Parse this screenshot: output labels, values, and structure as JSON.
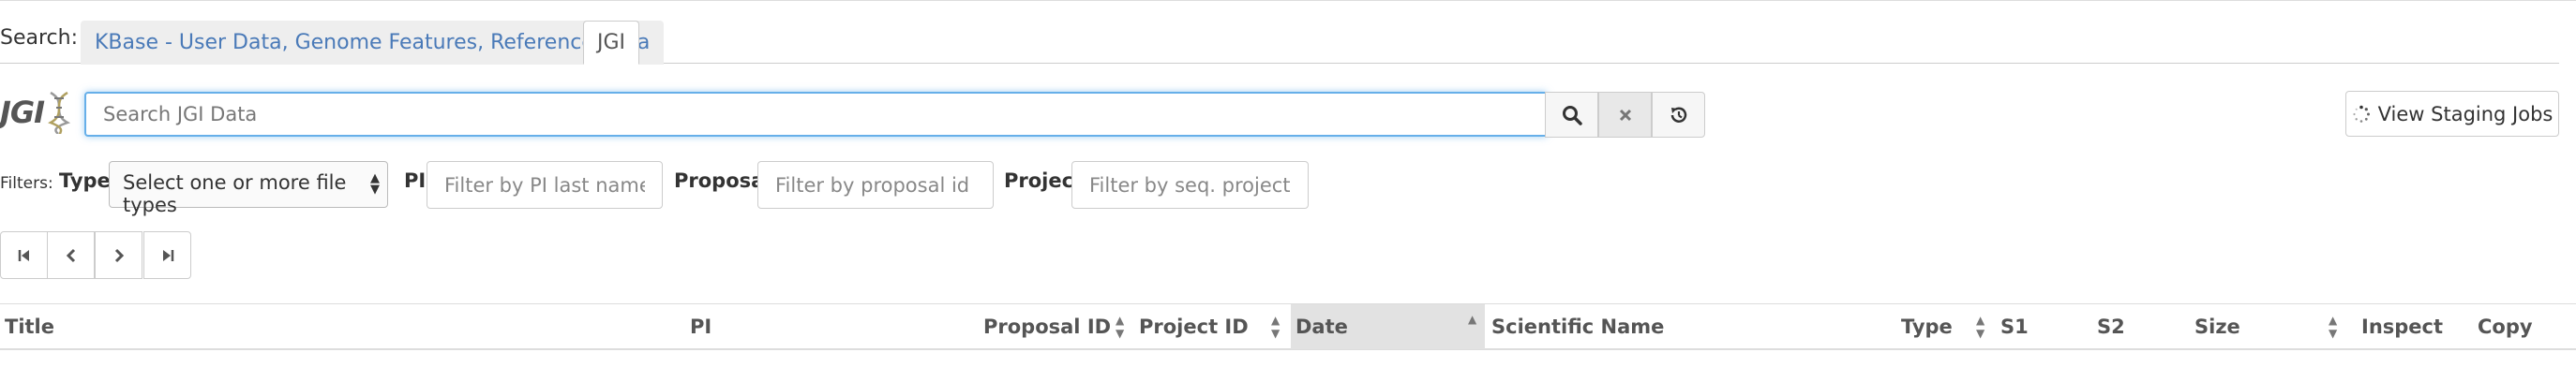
{
  "search_bar": {
    "label": "Search:",
    "tabs": [
      {
        "label": "KBase - User Data, Genome Features, Reference Data",
        "active": false
      },
      {
        "label": "JGI",
        "active": true
      }
    ]
  },
  "jgi": {
    "logo_text": "JGI",
    "search_placeholder": "Search JGI Data",
    "search_value": "",
    "staging_button_label": "View Staging Jobs"
  },
  "filters": {
    "label": "Filters:",
    "type_label": "Type",
    "type_select_value": "Select one or more file types",
    "pi_label": "PI",
    "pi_placeholder": "Filter by PI last name",
    "proposal_label": "Proposal",
    "proposal_placeholder": "Filter by proposal id",
    "project_label": "Project",
    "project_placeholder": "Filter by seq. project id"
  },
  "pagination": {
    "buttons": [
      "first-page",
      "previous-page",
      "next-page",
      "last-page"
    ]
  },
  "table": {
    "columns": [
      {
        "label": "Title",
        "sortable": false,
        "active": false
      },
      {
        "label": "PI",
        "sortable": false,
        "active": false
      },
      {
        "label": "Proposal ID",
        "sortable": true,
        "active": false
      },
      {
        "label": "Project ID",
        "sortable": true,
        "active": false
      },
      {
        "label": "Date",
        "sortable": true,
        "active": true,
        "sort_direction": "ascending"
      },
      {
        "label": "Scientific Name",
        "sortable": false,
        "active": false
      },
      {
        "label": "Type",
        "sortable": true,
        "active": false
      },
      {
        "label": "S1",
        "sortable": false,
        "active": false
      },
      {
        "label": "S2",
        "sortable": false,
        "active": false
      },
      {
        "label": "Size",
        "sortable": true,
        "active": false
      },
      {
        "label": "Inspect",
        "sortable": false,
        "active": false
      },
      {
        "label": "Copy",
        "sortable": false,
        "active": false
      }
    ],
    "rows": []
  },
  "colors": {
    "tab_link": "#4a7ab8",
    "focus_border": "#66afe9",
    "active_sort_header": "#e2e2e2"
  }
}
